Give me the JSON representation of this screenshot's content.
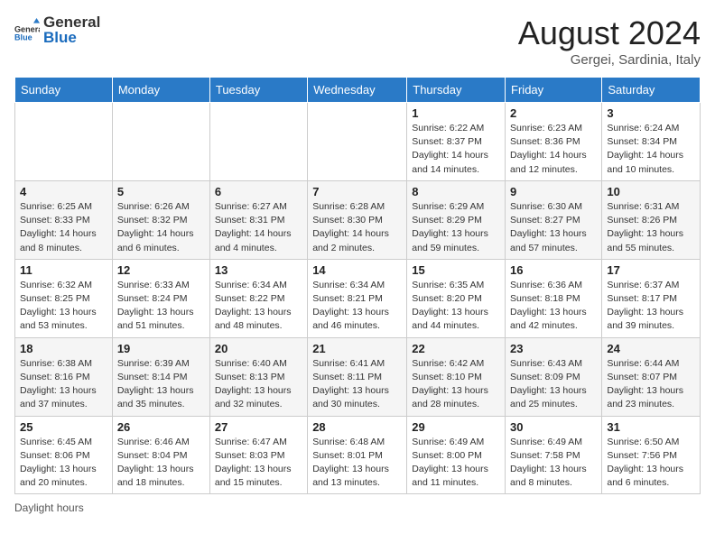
{
  "header": {
    "logo_general": "General",
    "logo_blue": "Blue",
    "month_year": "August 2024",
    "location": "Gergei, Sardinia, Italy"
  },
  "days_of_week": [
    "Sunday",
    "Monday",
    "Tuesday",
    "Wednesday",
    "Thursday",
    "Friday",
    "Saturday"
  ],
  "weeks": [
    [
      {
        "day": "",
        "info": ""
      },
      {
        "day": "",
        "info": ""
      },
      {
        "day": "",
        "info": ""
      },
      {
        "day": "",
        "info": ""
      },
      {
        "day": "1",
        "info": "Sunrise: 6:22 AM\nSunset: 8:37 PM\nDaylight: 14 hours and 14 minutes."
      },
      {
        "day": "2",
        "info": "Sunrise: 6:23 AM\nSunset: 8:36 PM\nDaylight: 14 hours and 12 minutes."
      },
      {
        "day": "3",
        "info": "Sunrise: 6:24 AM\nSunset: 8:34 PM\nDaylight: 14 hours and 10 minutes."
      }
    ],
    [
      {
        "day": "4",
        "info": "Sunrise: 6:25 AM\nSunset: 8:33 PM\nDaylight: 14 hours and 8 minutes."
      },
      {
        "day": "5",
        "info": "Sunrise: 6:26 AM\nSunset: 8:32 PM\nDaylight: 14 hours and 6 minutes."
      },
      {
        "day": "6",
        "info": "Sunrise: 6:27 AM\nSunset: 8:31 PM\nDaylight: 14 hours and 4 minutes."
      },
      {
        "day": "7",
        "info": "Sunrise: 6:28 AM\nSunset: 8:30 PM\nDaylight: 14 hours and 2 minutes."
      },
      {
        "day": "8",
        "info": "Sunrise: 6:29 AM\nSunset: 8:29 PM\nDaylight: 13 hours and 59 minutes."
      },
      {
        "day": "9",
        "info": "Sunrise: 6:30 AM\nSunset: 8:27 PM\nDaylight: 13 hours and 57 minutes."
      },
      {
        "day": "10",
        "info": "Sunrise: 6:31 AM\nSunset: 8:26 PM\nDaylight: 13 hours and 55 minutes."
      }
    ],
    [
      {
        "day": "11",
        "info": "Sunrise: 6:32 AM\nSunset: 8:25 PM\nDaylight: 13 hours and 53 minutes."
      },
      {
        "day": "12",
        "info": "Sunrise: 6:33 AM\nSunset: 8:24 PM\nDaylight: 13 hours and 51 minutes."
      },
      {
        "day": "13",
        "info": "Sunrise: 6:34 AM\nSunset: 8:22 PM\nDaylight: 13 hours and 48 minutes."
      },
      {
        "day": "14",
        "info": "Sunrise: 6:34 AM\nSunset: 8:21 PM\nDaylight: 13 hours and 46 minutes."
      },
      {
        "day": "15",
        "info": "Sunrise: 6:35 AM\nSunset: 8:20 PM\nDaylight: 13 hours and 44 minutes."
      },
      {
        "day": "16",
        "info": "Sunrise: 6:36 AM\nSunset: 8:18 PM\nDaylight: 13 hours and 42 minutes."
      },
      {
        "day": "17",
        "info": "Sunrise: 6:37 AM\nSunset: 8:17 PM\nDaylight: 13 hours and 39 minutes."
      }
    ],
    [
      {
        "day": "18",
        "info": "Sunrise: 6:38 AM\nSunset: 8:16 PM\nDaylight: 13 hours and 37 minutes."
      },
      {
        "day": "19",
        "info": "Sunrise: 6:39 AM\nSunset: 8:14 PM\nDaylight: 13 hours and 35 minutes."
      },
      {
        "day": "20",
        "info": "Sunrise: 6:40 AM\nSunset: 8:13 PM\nDaylight: 13 hours and 32 minutes."
      },
      {
        "day": "21",
        "info": "Sunrise: 6:41 AM\nSunset: 8:11 PM\nDaylight: 13 hours and 30 minutes."
      },
      {
        "day": "22",
        "info": "Sunrise: 6:42 AM\nSunset: 8:10 PM\nDaylight: 13 hours and 28 minutes."
      },
      {
        "day": "23",
        "info": "Sunrise: 6:43 AM\nSunset: 8:09 PM\nDaylight: 13 hours and 25 minutes."
      },
      {
        "day": "24",
        "info": "Sunrise: 6:44 AM\nSunset: 8:07 PM\nDaylight: 13 hours and 23 minutes."
      }
    ],
    [
      {
        "day": "25",
        "info": "Sunrise: 6:45 AM\nSunset: 8:06 PM\nDaylight: 13 hours and 20 minutes."
      },
      {
        "day": "26",
        "info": "Sunrise: 6:46 AM\nSunset: 8:04 PM\nDaylight: 13 hours and 18 minutes."
      },
      {
        "day": "27",
        "info": "Sunrise: 6:47 AM\nSunset: 8:03 PM\nDaylight: 13 hours and 15 minutes."
      },
      {
        "day": "28",
        "info": "Sunrise: 6:48 AM\nSunset: 8:01 PM\nDaylight: 13 hours and 13 minutes."
      },
      {
        "day": "29",
        "info": "Sunrise: 6:49 AM\nSunset: 8:00 PM\nDaylight: 13 hours and 11 minutes."
      },
      {
        "day": "30",
        "info": "Sunrise: 6:49 AM\nSunset: 7:58 PM\nDaylight: 13 hours and 8 minutes."
      },
      {
        "day": "31",
        "info": "Sunrise: 6:50 AM\nSunset: 7:56 PM\nDaylight: 13 hours and 6 minutes."
      }
    ]
  ],
  "footer": {
    "daylight_label": "Daylight hours"
  }
}
